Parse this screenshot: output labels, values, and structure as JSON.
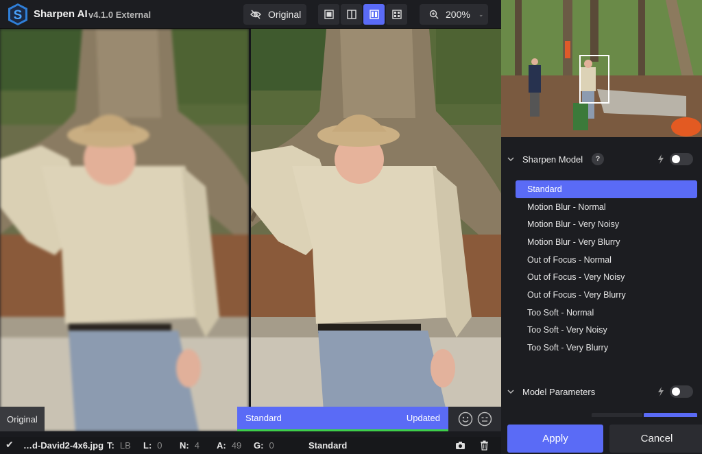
{
  "app": {
    "name": "Sharpen AI",
    "version": "v4.1.0 External"
  },
  "toolbar": {
    "original_label": "Original",
    "zoom_label": "200%",
    "views": [
      "single-view-icon",
      "split-view-icon",
      "side-by-side-view-icon",
      "quad-view-icon"
    ],
    "active_view": 2
  },
  "preview": {
    "left_label": "Original",
    "compare_left": "Standard",
    "compare_right": "Updated"
  },
  "status": {
    "filename": "…d-David2-4x6.jpg",
    "t_key": "T:",
    "t_val": "LB",
    "l_key": "L:",
    "l_val": "0",
    "n_key": "N:",
    "n_val": "4",
    "a_key": "A:",
    "a_val": "49",
    "g_key": "G:",
    "g_val": "0",
    "model": "Standard"
  },
  "panel": {
    "sharpen_title": "Sharpen Model",
    "help": "?",
    "models": [
      "Standard",
      "Motion Blur - Normal",
      "Motion Blur - Very Noisy",
      "Motion Blur - Very Blurry",
      "Out of Focus - Normal",
      "Out of Focus - Very Noisy",
      "Out of Focus - Very Blurry",
      "Too Soft - Normal",
      "Too Soft - Very Noisy",
      "Too Soft - Very Blurry"
    ],
    "selected_model": 0,
    "params_title": "Model Parameters",
    "apply": "Apply",
    "cancel": "Cancel"
  },
  "colors": {
    "accent": "#5a6bf6",
    "green": "#3ecf4a",
    "bg": "#1c1d21"
  }
}
